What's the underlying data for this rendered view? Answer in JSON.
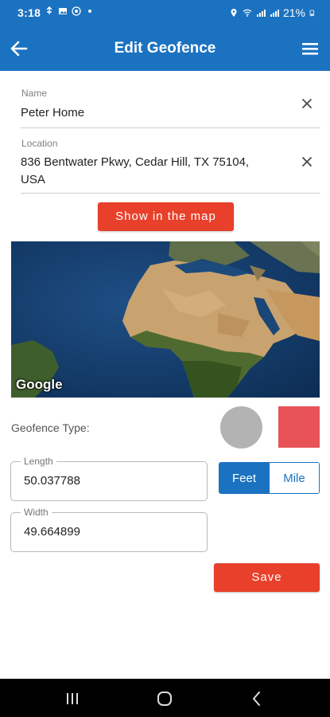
{
  "status_bar": {
    "time": "3:18",
    "left_icons": [
      "usb-icon",
      "image-icon",
      "whatsapp-icon",
      "dot-icon"
    ],
    "battery_text": "21%",
    "right_icons": [
      "location-icon",
      "wifi-icon",
      "signal-icon",
      "signal-icon",
      "battery-icon"
    ]
  },
  "app_bar": {
    "title": "Edit Geofence",
    "back_icon": "back-arrow-icon",
    "menu_icon": "hamburger-menu-icon"
  },
  "name_field": {
    "label": "Name",
    "value": "Peter Home"
  },
  "location_field": {
    "label": "Location",
    "value_line1": "836 Bentwater Pkwy, Cedar Hill, TX 75104,",
    "value_line2": "USA"
  },
  "show_map_button": "Show in the map",
  "map": {
    "attribution": "Google"
  },
  "geofence_type": {
    "label": "Geofence Type:",
    "options": [
      "circle",
      "rectangle"
    ],
    "selected": "rectangle"
  },
  "length_field": {
    "label": "Length",
    "value": "50.037788"
  },
  "width_field": {
    "label": "Width",
    "value": "49.664899"
  },
  "units": {
    "options": [
      "Feet",
      "Mile"
    ],
    "selected": "Feet"
  },
  "save_button": "Save",
  "colors": {
    "primary": "#1b72c0",
    "accent": "#e8402a",
    "rect_shape": "#e85357",
    "circle_shape": "#b3b3b3"
  }
}
